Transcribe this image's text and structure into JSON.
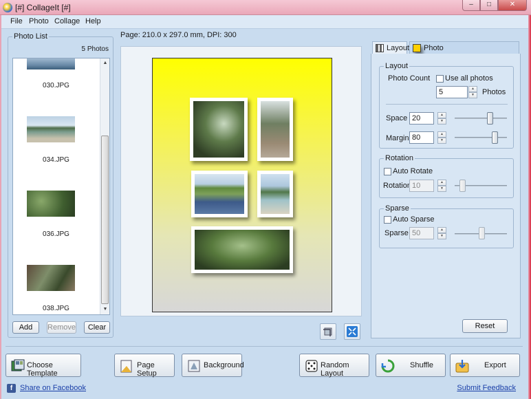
{
  "window": {
    "title": "[#] CollageIt [#]"
  },
  "menu": [
    "File",
    "Photo",
    "Collage",
    "Help"
  ],
  "page_info": "Page: 210.0 x 297.0 mm, DPI: 300",
  "photo_list": {
    "title": "Photo List",
    "count": "5 Photos",
    "items": [
      "030.JPG",
      "034.JPG",
      "036.JPG",
      "038.JPG"
    ],
    "buttons": {
      "add": "Add",
      "remove": "Remove",
      "clear": "Clear"
    }
  },
  "tabs": {
    "layout": "Layout",
    "photo": "Photo"
  },
  "layout_group": {
    "title": "Layout",
    "photo_count_label": "Photo Count",
    "use_all_photos": "Use all photos",
    "photo_count_value": "5",
    "photos_unit": "Photos",
    "space_label": "Space",
    "space_value": "20",
    "margin_label": "Margin",
    "margin_value": "80"
  },
  "rotation_group": {
    "title": "Rotation",
    "auto_rotate": "Auto Rotate",
    "rotation_label": "Rotation",
    "rotation_value": "10"
  },
  "sparse_group": {
    "title": "Sparse",
    "auto_sparse": "Auto Sparse",
    "sparse_label": "Sparse",
    "sparse_value": "50"
  },
  "reset": "Reset",
  "bottom_buttons": {
    "choose_template": "Choose Template",
    "page_setup": "Page Setup",
    "background": "Background",
    "random_layout": "Random Layout",
    "shuffle": "Shuffle",
    "export": "Export"
  },
  "status": {
    "share": "Share on Facebook",
    "feedback": "Submit Feedback"
  },
  "colors": {
    "page_top": "#ffff00",
    "page_bottom": "#d7d7d7",
    "frame": "#e7a4b5",
    "link": "#1a3fa8"
  }
}
